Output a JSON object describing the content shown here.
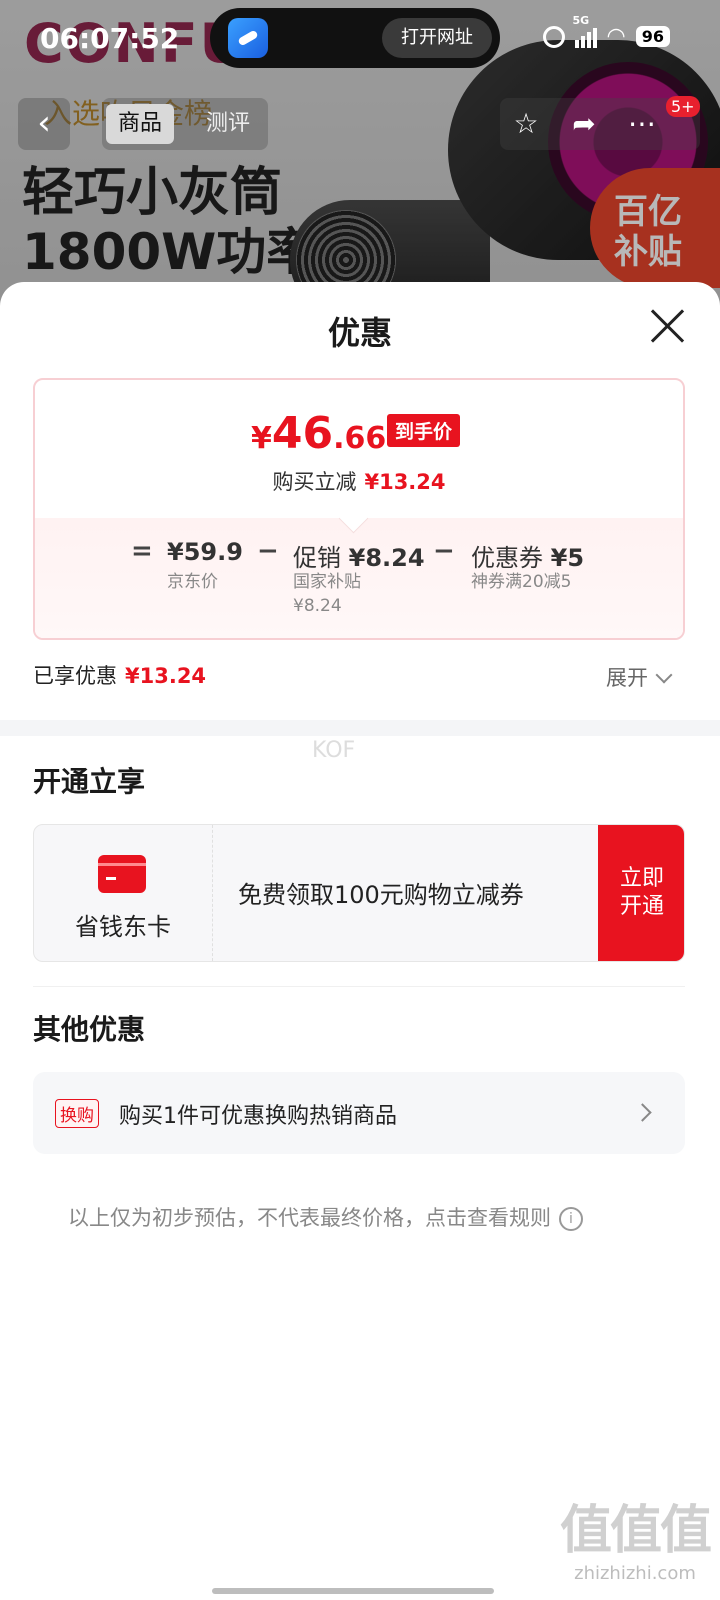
{
  "status_bar": {
    "time": "06:07:52",
    "open_url_label": "打开网址",
    "network": "5G",
    "battery": "96"
  },
  "background_product": {
    "brand": "CONFU",
    "rank_tag": "入选吹风金榜",
    "slogan_line1": "轻巧小灰筒",
    "slogan_line2": "1800W功率",
    "subsidy_badge_line1": "百亿",
    "subsidy_badge_line2": "补贴"
  },
  "nav": {
    "tab_product": "商品",
    "tab_review": "测评",
    "more_badge": "5+"
  },
  "sheet": {
    "title": "优惠",
    "final_price": {
      "currency": "¥",
      "integer": "46",
      "decimal": ".66",
      "tag": "到手价"
    },
    "saving_label": "购买立减",
    "saving_amount": "¥13.24",
    "breakdown": {
      "equals": "=",
      "jd_price": "¥59.9",
      "jd_price_label": "京东价",
      "minus1": "−",
      "promo_label": "促销",
      "promo_amount": "¥8.24",
      "promo_sub1": "国家补贴",
      "promo_sub2": "¥8.24",
      "minus2": "−",
      "coupon_label": "优惠券",
      "coupon_amount": "¥5",
      "coupon_sub": "神券满20减5"
    },
    "enjoyed_label": "已享优惠",
    "enjoyed_amount": "¥13.24",
    "expand_label": "展开",
    "watermark_text": "KOF",
    "section_open": "开通立享",
    "card": {
      "name": "省钱东卡",
      "desc": "免费领取100元购物立减券",
      "btn_line1": "立即",
      "btn_line2": "开通"
    },
    "section_other": "其他优惠",
    "promo": {
      "tag": "换购",
      "text": "购买1件可优惠换购热销商品"
    },
    "disclaimer": "以上仅为初步预估，不代表最终价格，点击查看规则",
    "info_glyph": "i"
  },
  "site_watermark": {
    "big": "值值值",
    "small": "zhizhizhi.com"
  },
  "colors": {
    "accent_red": "#e8131f",
    "border_pink": "#f7cfd3"
  }
}
